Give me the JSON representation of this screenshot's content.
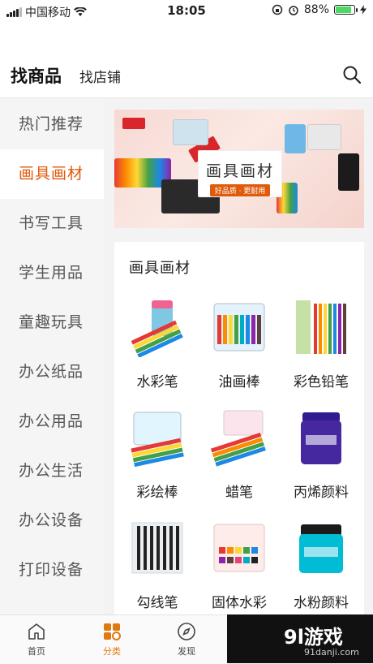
{
  "status_bar": {
    "carrier": "中国移动",
    "time": "18:05",
    "battery_percent": "88%",
    "battery_level": 0.88
  },
  "header": {
    "tab_active": "找商品",
    "tab_inactive": "找店铺",
    "search_icon": "search-icon"
  },
  "sidebar": {
    "items": [
      {
        "label": "热门推荐",
        "active": false
      },
      {
        "label": "画具画材",
        "active": true
      },
      {
        "label": "书写工具",
        "active": false
      },
      {
        "label": "学生用品",
        "active": false
      },
      {
        "label": "童趣玩具",
        "active": false
      },
      {
        "label": "办公纸品",
        "active": false
      },
      {
        "label": "办公用品",
        "active": false
      },
      {
        "label": "办公生活",
        "active": false
      },
      {
        "label": "办公设备",
        "active": false
      },
      {
        "label": "打印设备",
        "active": false
      }
    ]
  },
  "banner": {
    "title": "画具画材",
    "badge": "好品质 · 更耐用",
    "brand_color": "#d9262c"
  },
  "section": {
    "title": "画具画材",
    "items": [
      {
        "label": "水彩笔"
      },
      {
        "label": "油画棒"
      },
      {
        "label": "彩色铅笔"
      },
      {
        "label": "彩绘棒"
      },
      {
        "label": "蜡笔"
      },
      {
        "label": "丙烯颜料"
      },
      {
        "label": "勾线笔"
      },
      {
        "label": "固体水彩"
      },
      {
        "label": "水粉颜料"
      }
    ]
  },
  "tabbar": {
    "items": [
      {
        "label": "首页",
        "icon": "home-icon"
      },
      {
        "label": "分类",
        "icon": "category-icon",
        "active": true
      },
      {
        "label": "发现",
        "icon": "compass-icon"
      }
    ]
  },
  "watermark": {
    "main": "9l游戏",
    "sub": "91danji.com"
  },
  "colors": {
    "accent": "#e05a0a",
    "tab_active": "#e07a10"
  }
}
